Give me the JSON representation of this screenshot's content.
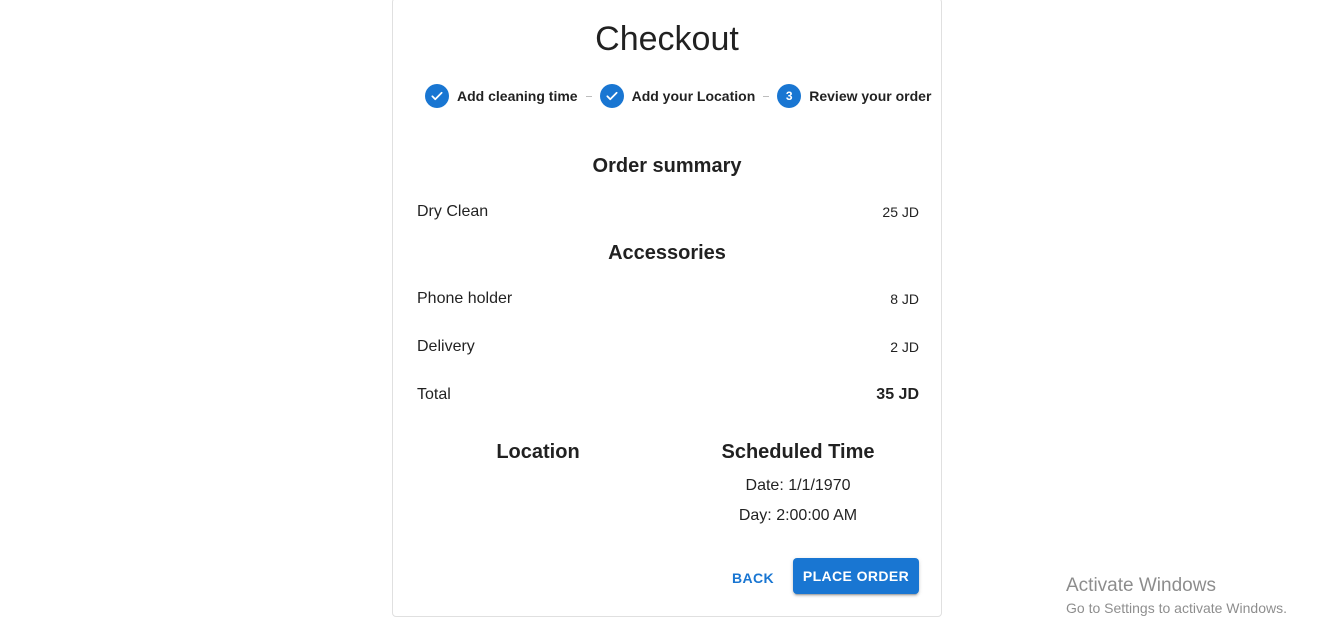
{
  "page": {
    "title": "Checkout"
  },
  "stepper": {
    "steps": [
      {
        "label": "Add cleaning time",
        "state": "completed",
        "icon": "check-icon"
      },
      {
        "label": "Add your Location",
        "state": "completed",
        "icon": "check-icon"
      },
      {
        "label": "Review your order",
        "state": "active",
        "number": "3"
      }
    ]
  },
  "summary": {
    "heading": "Order summary",
    "service": {
      "name": "Dry Clean",
      "price": "25 JD"
    },
    "accessories_heading": "Accessories",
    "items": [
      {
        "name": "Phone holder",
        "price": "8 JD"
      },
      {
        "name": "Delivery",
        "price": "2 JD"
      }
    ],
    "total": {
      "name": "Total",
      "price": "35 JD"
    }
  },
  "details": {
    "location_heading": "Location",
    "scheduled_heading": "Scheduled Time",
    "date": "Date: 1/1/1970",
    "day": "Day: 2:00:00 AM"
  },
  "actions": {
    "back_label": "BACK",
    "place_order_label": "PLACE ORDER"
  },
  "watermark": {
    "title": "Activate Windows",
    "subtitle": "Go to Settings to activate Windows."
  },
  "colors": {
    "primary": "#1976d2"
  }
}
